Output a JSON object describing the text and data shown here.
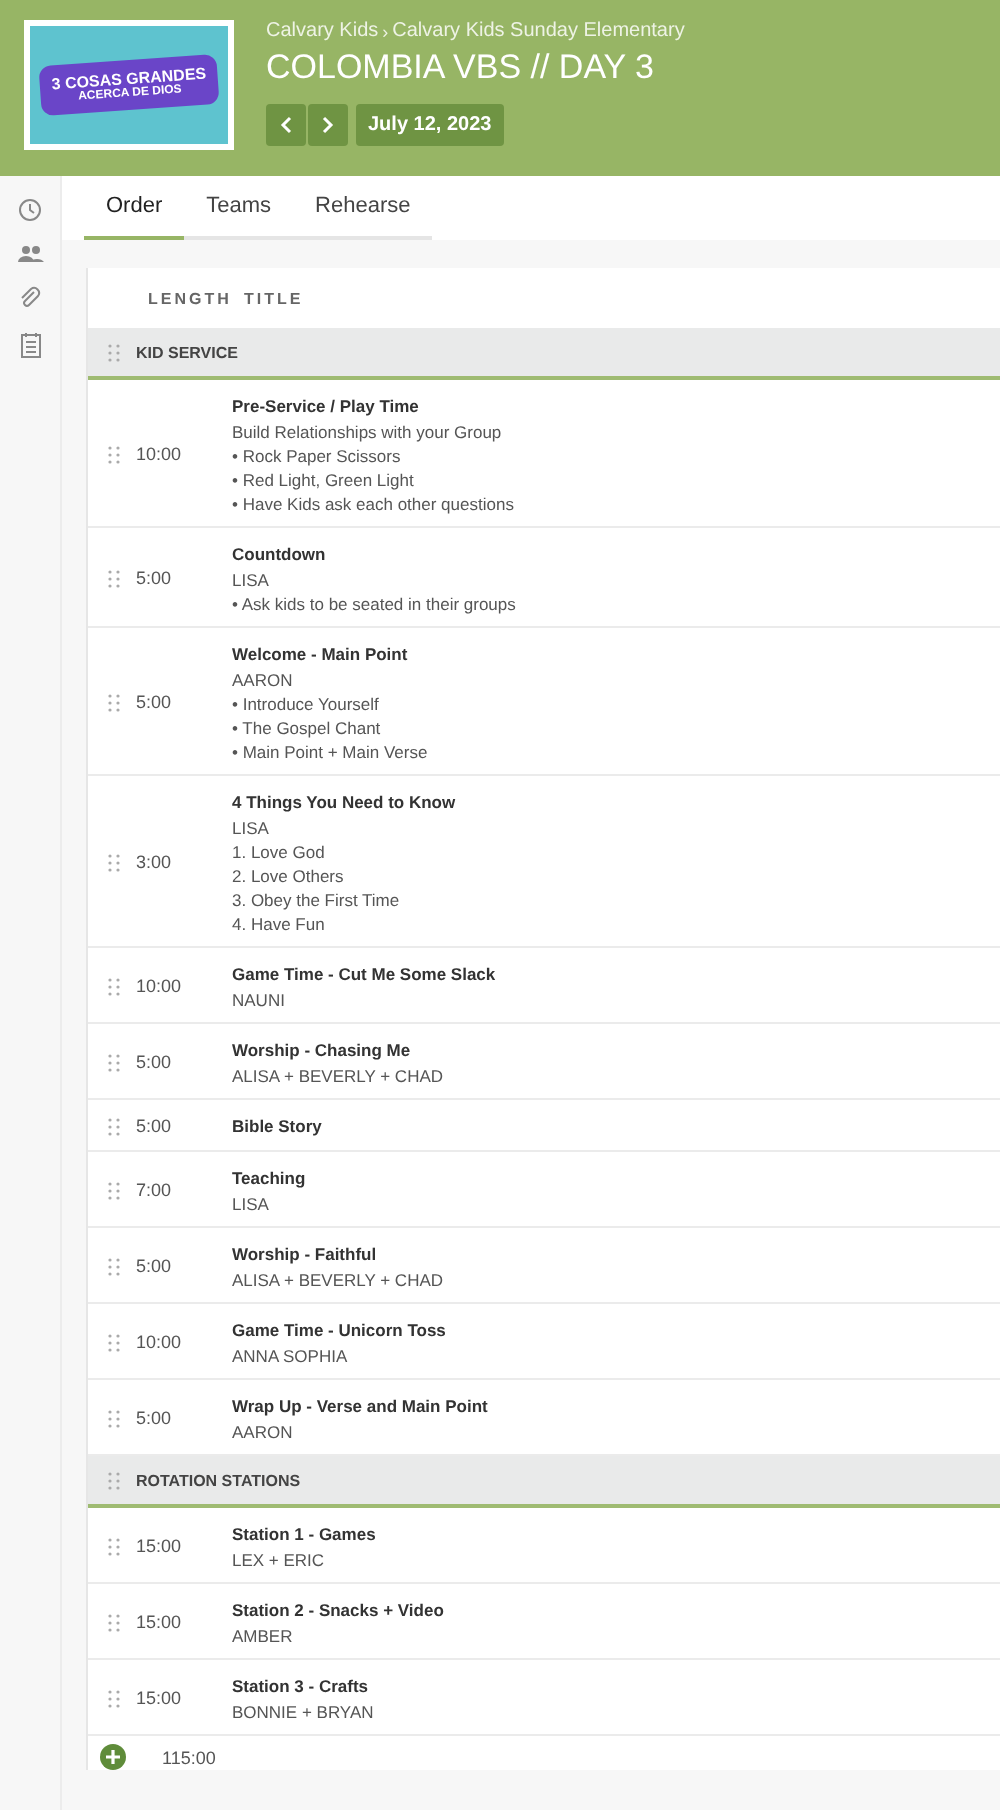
{
  "header": {
    "artwork": {
      "line_1": "3 COSAS GRANDES",
      "line_2": "ACERCA DE DIOS"
    },
    "breadcrumb": [
      "Calvary Kids",
      "Calvary Kids Sunday Elementary"
    ],
    "breadcrumb_separator": "›",
    "title": "COLOMBIA VBS // DAY 3",
    "date": "July 12, 2023"
  },
  "tabs": [
    {
      "label": "Order",
      "selected": true
    },
    {
      "label": "Teams",
      "selected": false
    },
    {
      "label": "Rehearse",
      "selected": false
    }
  ],
  "table": {
    "columns": [
      "LENGTH",
      "TITLE"
    ],
    "sections": [
      {
        "name": "KID SERVICE",
        "rows": [
          {
            "length": "10:00",
            "title": "Pre-Service / Play Time",
            "lines": [
              "Build Relationships with your Group",
              "• Rock Paper Scissors",
              "• Red Light, Green Light",
              "• Have Kids ask each other questions"
            ]
          },
          {
            "length": "5:00",
            "title": "Countdown",
            "lines": [
              "LISA",
              "• Ask kids to be seated in their groups"
            ]
          },
          {
            "length": "5:00",
            "title": "Welcome - Main Point",
            "lines": [
              "AARON",
              "• Introduce Yourself",
              "• The Gospel Chant",
              "• Main Point + Main Verse"
            ]
          },
          {
            "length": "3:00",
            "title": "4 Things You Need to Know",
            "lines": [
              "LISA",
              "1. Love God",
              "2. Love Others",
              "3. Obey the First Time",
              "4. Have Fun"
            ]
          },
          {
            "length": "10:00",
            "title": "Game Time - Cut Me Some Slack",
            "lines": [
              "NAUNI"
            ]
          },
          {
            "length": "5:00",
            "title": "Worship - Chasing Me",
            "lines": [
              "ALISA + BEVERLY + CHAD"
            ]
          },
          {
            "length": "5:00",
            "title": "Bible Story",
            "lines": []
          },
          {
            "length": "7:00",
            "title": "Teaching",
            "lines": [
              "LISA"
            ]
          },
          {
            "length": "5:00",
            "title": "Worship - Faithful",
            "lines": [
              "ALISA + BEVERLY + CHAD"
            ]
          },
          {
            "length": "10:00",
            "title": "Game Time - Unicorn Toss",
            "lines": [
              "ANNA SOPHIA"
            ]
          },
          {
            "length": "5:00",
            "title": "Wrap Up - Verse and Main Point",
            "lines": [
              "AARON"
            ]
          }
        ]
      },
      {
        "name": "ROTATION STATIONS",
        "rows": [
          {
            "length": "15:00",
            "title": "Station 1 - Games",
            "lines": [
              "LEX + ERIC"
            ]
          },
          {
            "length": "15:00",
            "title": "Station 2 - Snacks + Video",
            "lines": [
              "AMBER"
            ]
          },
          {
            "length": "15:00",
            "title": "Station 3 - Crafts",
            "lines": [
              "BONNIE + BRYAN"
            ]
          }
        ]
      }
    ],
    "total": "115:00"
  }
}
